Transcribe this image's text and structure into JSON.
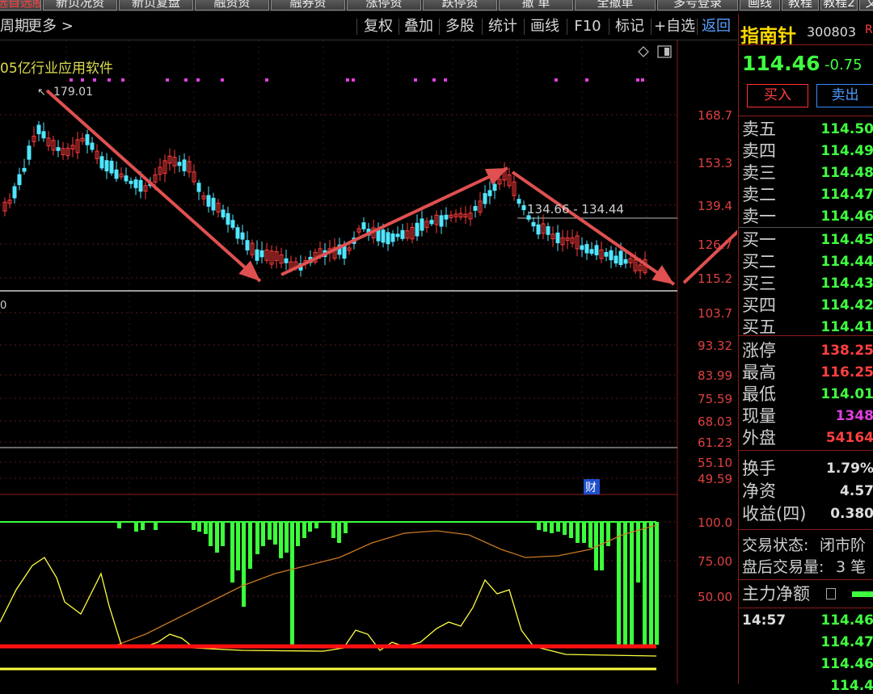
{
  "top_tabs": [
    {
      "label": "选自选股",
      "active": true
    },
    {
      "label": "新页况资"
    },
    {
      "label": "新页复盘"
    },
    {
      "label": "融资资"
    },
    {
      "label": "融券资"
    },
    {
      "label": "涨停资"
    },
    {
      "label": "跌停资"
    },
    {
      "label": "撤  单"
    },
    {
      "label": "全撤单"
    },
    {
      "label": "多号登录"
    },
    {
      "label": "画线"
    },
    {
      "label": "教程"
    },
    {
      "label": "教程2"
    },
    {
      "label": "文"
    }
  ],
  "toolbar": {
    "period": "周期",
    "more": "更多",
    "items": [
      "复权",
      "叠加",
      "多股",
      "统计",
      "画线",
      "F10",
      "标记",
      "+自选"
    ],
    "back": "返回"
  },
  "chart_header": {
    "cap_suffix": "05亿",
    "industry": "行业应用软件"
  },
  "chart_labels": {
    "high_marker": "179.01",
    "range_label": "134.66 - 134.44",
    "finance_badge": "财",
    "left_cut_value": "0"
  },
  "colors": {
    "up": "#ff3b3b",
    "down": "#50e6ff",
    "indicator_bar": "#3cff3c",
    "ma": "#c87820",
    "yellow": "#ffff40",
    "arrow": "#e05050",
    "magenta": "#e040e0"
  },
  "price_axis": [
    "168.7",
    "153.3",
    "139.4",
    "126.7",
    "115.2",
    "103.7",
    "93.32",
    "83.99",
    "75.59",
    "68.03",
    "61.23",
    "55.10",
    "49.59"
  ],
  "indicator_axis": [
    "100.0",
    "75.00",
    "50.00"
  ],
  "quote": {
    "name": "指南针",
    "code": "300803",
    "code_suffix": "R",
    "price": "114.46",
    "change": "-0.75",
    "buy_button": "买入",
    "sell_button": "卖出"
  },
  "order_book": {
    "sell": [
      {
        "label": "卖五",
        "price": "114.50"
      },
      {
        "label": "卖四",
        "price": "114.49"
      },
      {
        "label": "卖三",
        "price": "114.48"
      },
      {
        "label": "卖二",
        "price": "114.47"
      },
      {
        "label": "卖一",
        "price": "114.46"
      }
    ],
    "buy": [
      {
        "label": "买一",
        "price": "114.45"
      },
      {
        "label": "买二",
        "price": "114.44"
      },
      {
        "label": "买三",
        "price": "114.43"
      },
      {
        "label": "买四",
        "price": "114.42"
      },
      {
        "label": "买五",
        "price": "114.41"
      }
    ]
  },
  "stats": [
    {
      "label": "涨停",
      "value": "138.25",
      "color": "#ff4040"
    },
    {
      "label": "最高",
      "value": "116.25",
      "color": "#ff4040"
    },
    {
      "label": "最低",
      "value": "114.01",
      "color": "#40ff40"
    },
    {
      "label": "现量",
      "value": "1348",
      "color": "#e040e0"
    },
    {
      "label": "外盘",
      "value": "54164",
      "color": "#ff4040"
    }
  ],
  "stats2": [
    {
      "label": "换手",
      "value": "1.79%"
    },
    {
      "label": "净资",
      "value": "4.57"
    },
    {
      "label": "收益(四)",
      "value": "0.380"
    }
  ],
  "trade_status": {
    "label": "交易状态:",
    "value": "闭市阶"
  },
  "after_volume": {
    "label": "盘后交易量:",
    "value": "3 笔"
  },
  "main_flow": {
    "label": "主力净额"
  },
  "ticks": {
    "time": "14:57",
    "prices": [
      "114.46",
      "114.47",
      "114.46",
      "114.4"
    ]
  }
}
